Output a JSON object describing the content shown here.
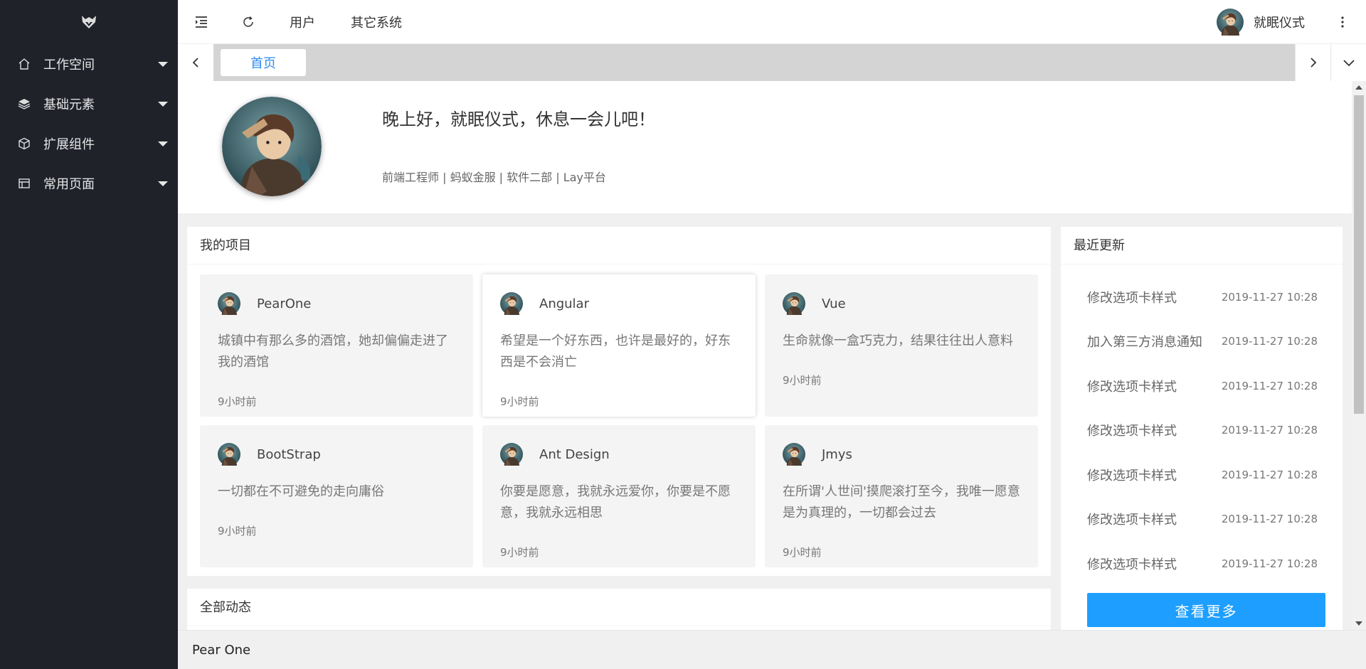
{
  "header": {
    "nav_user": "用户",
    "nav_other": "其它系统",
    "username": "就眠仪式"
  },
  "sidebar": {
    "items": [
      {
        "label": "工作空间",
        "icon": "home-icon"
      },
      {
        "label": "基础元素",
        "icon": "layers-icon"
      },
      {
        "label": "扩展组件",
        "icon": "cube-icon"
      },
      {
        "label": "常用页面",
        "icon": "window-icon"
      }
    ]
  },
  "tabs": {
    "home": "首页"
  },
  "profile": {
    "greeting": "晚上好，就眠仪式，休息一会儿吧！",
    "tagline": "前端工程师 | 蚂蚁金服 | 软件二部 | Lay平台"
  },
  "projects": {
    "title": "我的项目",
    "items": [
      {
        "name": "PearOne",
        "desc": "城镇中有那么多的酒馆，她却偏偏走进了我的酒馆",
        "time": "9小时前"
      },
      {
        "name": "Angular",
        "desc": "希望是一个好东西，也许是最好的，好东西是不会消亡",
        "time": "9小时前"
      },
      {
        "name": "Vue",
        "desc": "生命就像一盒巧克力，结果往往出人意料",
        "time": "9小时前"
      },
      {
        "name": "BootStrap",
        "desc": "一切都在不可避免的走向庸俗",
        "time": "9小时前"
      },
      {
        "name": "Ant Design",
        "desc": "你要是愿意，我就永远爱你，你要是不愿意，我就永远相思",
        "time": "9小时前"
      },
      {
        "name": "Jmys",
        "desc": "在所谓'人世间'摸爬滚打至今，我唯一愿意是为真理的，一切都会过去",
        "time": "9小时前"
      }
    ]
  },
  "updates": {
    "title": "最近更新",
    "items": [
      {
        "text": "修改选项卡样式",
        "date": "2019-11-27 10:28"
      },
      {
        "text": "加入第三方消息通知",
        "date": "2019-11-27 10:28"
      },
      {
        "text": "修改选项卡样式",
        "date": "2019-11-27 10:28"
      },
      {
        "text": "修改选项卡样式",
        "date": "2019-11-27 10:28"
      },
      {
        "text": "修改选项卡样式",
        "date": "2019-11-27 10:28"
      },
      {
        "text": "修改选项卡样式",
        "date": "2019-11-27 10:28"
      },
      {
        "text": "修改选项卡样式",
        "date": "2019-11-27 10:28"
      }
    ],
    "more": "查看更多"
  },
  "activity": {
    "title": "全部动态"
  },
  "footer": {
    "text": "Pear One"
  },
  "colors": {
    "sidebar": "#20222a",
    "accent": "#1e9fff",
    "tab_active": "#2d8cf0"
  }
}
